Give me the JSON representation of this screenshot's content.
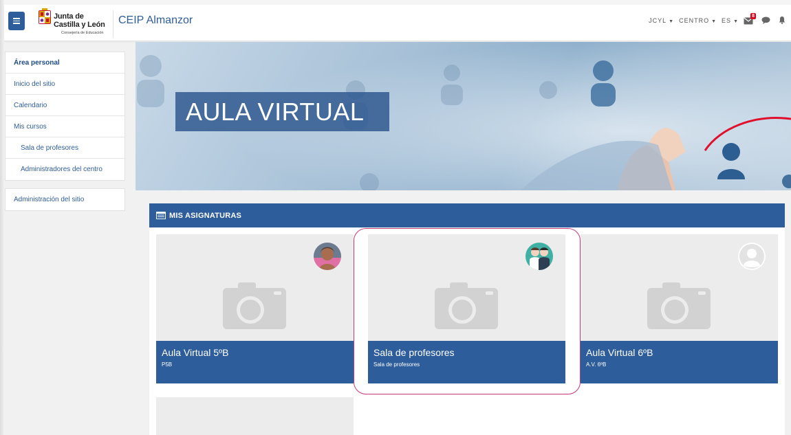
{
  "navbar": {
    "logo": {
      "line1": "Junta de",
      "line2": "Castilla y León",
      "line3": "Consejería de Educación"
    },
    "site_name": "CEIP Almanzor",
    "menus": [
      {
        "label": "JCYL"
      },
      {
        "label": "CENTRO"
      },
      {
        "label": "ES"
      }
    ],
    "messages_badge": "8",
    "icons": {
      "menu": "hamburger-menu-icon",
      "messages": "envelope-icon",
      "chat": "chat-bubble-icon",
      "notifications": "bell-icon"
    }
  },
  "sidebar": {
    "items": [
      {
        "label": "Área personal"
      },
      {
        "label": "Inicio del sitio"
      },
      {
        "label": "Calendario"
      },
      {
        "label": "Mis cursos"
      },
      {
        "label": "Sala de profesores"
      },
      {
        "label": "Administradores del centro"
      }
    ],
    "admin": {
      "label": "Administración del sitio"
    }
  },
  "hero": {
    "title": "AULA VIRTUAL"
  },
  "courses": {
    "title": "MIS ASIGNATURAS",
    "cards": [
      {
        "name": "Aula Virtual 5ºB",
        "shortname": "P5B"
      },
      {
        "name": "Sala de profesores",
        "shortname": "Sala de profesores"
      },
      {
        "name": "Aula Virtual 6ºB",
        "shortname": "A.V. 6ºB"
      }
    ]
  },
  "colors": {
    "primary": "#2e5d9b",
    "highlight": "#c7387a",
    "badge": "#d9001b"
  }
}
